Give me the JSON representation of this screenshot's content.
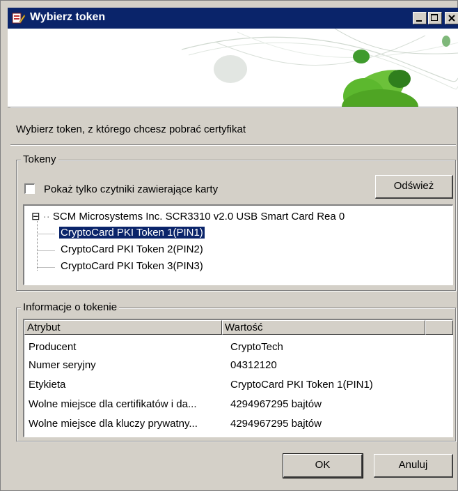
{
  "window": {
    "title": "Wybierz token"
  },
  "instruction": "Wybierz token, z którego chcesz pobrać certyfikat",
  "tokens_group": {
    "legend": "Tokeny",
    "checkbox_label": "Pokaż tylko czytniki zawierające karty",
    "checkbox_checked": false,
    "refresh_label": "Odśwież",
    "tree": {
      "root": "SCM Microsystems Inc. SCR3310 v2.0 USB Smart Card Rea 0",
      "root_expander": "⊟",
      "children": [
        "CryptoCard PKI Token 1(PIN1)",
        "CryptoCard PKI Token 2(PIN2)",
        "CryptoCard PKI Token 3(PIN3)"
      ],
      "selected_index": 0
    }
  },
  "info_group": {
    "legend": "Informacje o tokenie",
    "columns": [
      "Atrybut",
      "Wartość"
    ],
    "rows": [
      {
        "attr": "Producent",
        "value": "CryptoTech"
      },
      {
        "attr": "Numer seryjny",
        "value": "04312120"
      },
      {
        "attr": "Etykieta",
        "value": "CryptoCard PKI Token 1(PIN1)"
      },
      {
        "attr": "Wolne miejsce dla certifikatów i da...",
        "value": "4294967295 bajtów"
      },
      {
        "attr": "Wolne miejsce dla kluczy prywatny...",
        "value": "4294967295 bajtów"
      }
    ]
  },
  "buttons": {
    "ok": "OK",
    "cancel": "Anuluj"
  },
  "colors": {
    "titlebar": "#0a246a",
    "face": "#d4d0c8",
    "selection": "#0a246a",
    "banner_green": "#5cb82e"
  }
}
